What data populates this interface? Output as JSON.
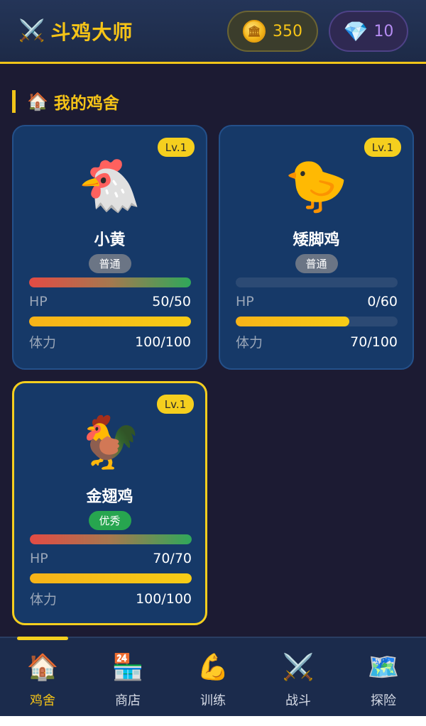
{
  "header": {
    "title_icon": "⚔️",
    "title": "斗鸡大师",
    "coins": "350",
    "coin_icon_glyph": "🏛",
    "gems": "10",
    "gem_icon": "💎"
  },
  "section": {
    "icon": "🏠",
    "title": "我的鸡舍"
  },
  "chickens": [
    {
      "level": "Lv.1",
      "emoji": "🐔",
      "name": "小黄",
      "rarity": "普通",
      "hp_label": "HP",
      "hp": "50/50",
      "hp_fraction": 1.0,
      "stamina_label": "体力",
      "stamina": "100/100",
      "stamina_fraction": 1.0
    },
    {
      "level": "Lv.1",
      "emoji": "🐤",
      "name": "矮脚鸡",
      "rarity": "普通",
      "hp_label": "HP",
      "hp": "0/60",
      "hp_fraction": 0.0,
      "stamina_label": "体力",
      "stamina": "70/100",
      "stamina_fraction": 0.7
    },
    {
      "level": "Lv.1",
      "emoji": "🐓",
      "name": "金翅鸡",
      "rarity": "优秀",
      "hp_label": "HP",
      "hp": "70/70",
      "hp_fraction": 1.0,
      "stamina_label": "体力",
      "stamina": "100/100",
      "stamina_fraction": 1.0
    }
  ],
  "nav": [
    {
      "icon": "🏠",
      "label": "鸡舍",
      "active": true
    },
    {
      "icon": "🏪",
      "label": "商店",
      "active": false
    },
    {
      "icon": "💪",
      "label": "训练",
      "active": false
    },
    {
      "icon": "⚔️",
      "label": "战斗",
      "active": false
    },
    {
      "icon": "🗺️",
      "label": "探险",
      "active": false
    }
  ],
  "colors": {
    "accent": "#f5cf1e",
    "background": "#1c1b33",
    "card": "#163968",
    "rarity_common": "#6b7585",
    "rarity_excellent": "#27a54f"
  }
}
